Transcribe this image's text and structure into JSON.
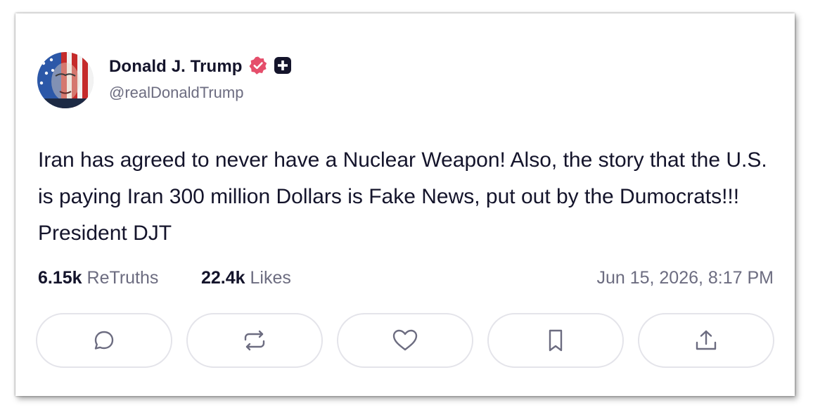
{
  "post": {
    "author": {
      "display_name": "Donald J. Trump",
      "handle": "@realDonaldTrump",
      "verified_icon": "verified-badge-icon",
      "extra_badge_icon": "plus-badge-icon"
    },
    "text": "Iran has agreed to never have a Nuclear Weapon! Also, the story that the U.S. is paying Iran 300 million Dollars is Fake News, put out by the Dumocrats!!! President DJT",
    "stats": {
      "retruths_count": "6.15k",
      "retruths_label": "ReTruths",
      "likes_count": "22.4k",
      "likes_label": "Likes"
    },
    "timestamp": "Jun 15, 2026, 8:17 PM",
    "actions": [
      {
        "icon": "comment-icon"
      },
      {
        "icon": "retruth-icon"
      },
      {
        "icon": "heart-icon"
      },
      {
        "icon": "bookmark-icon"
      },
      {
        "icon": "share-icon"
      }
    ]
  },
  "colors": {
    "text_primary": "#14142b",
    "text_secondary": "#6c6c80",
    "verified_badge": "#e54e6b",
    "button_border": "#e4e4ea"
  }
}
